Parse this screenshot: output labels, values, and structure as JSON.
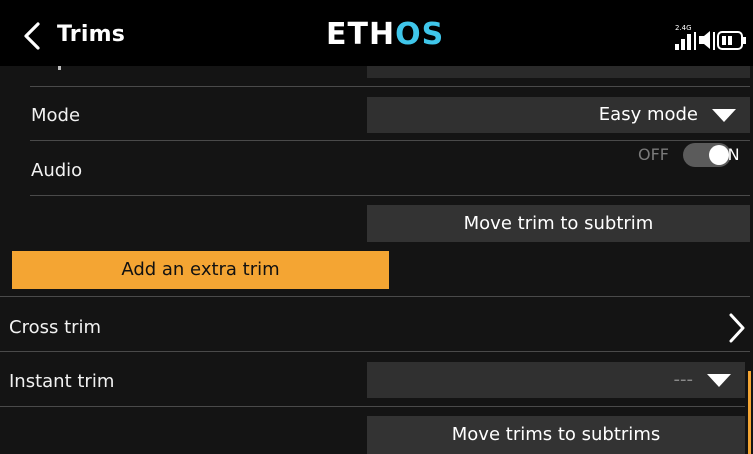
{
  "header": {
    "title": "Trims",
    "logo_part1": "ETH",
    "logo_part2": "OS",
    "status_band": "2.4G"
  },
  "rows": {
    "mode": {
      "label": "Mode",
      "value": "Easy mode"
    },
    "audio": {
      "label": "Audio",
      "off_label": "OFF",
      "on_label": "ON",
      "state": "on"
    },
    "move_trim_button": "Move trim to subtrim",
    "add_extra_trim_button": "Add an extra trim",
    "cross_trim": {
      "label": "Cross trim"
    },
    "instant_trim": {
      "label": "Instant trim",
      "value": "---"
    },
    "move_trims_button": "Move trims to subtrims"
  },
  "colors": {
    "background": "#141414",
    "accent_orange": "#f4a533",
    "logo_blue": "#3fc6ea",
    "field": "#303030"
  },
  "icons": {
    "back": "chevron-left-icon",
    "signal": "signal-bars-icon",
    "volume": "speaker-icon",
    "battery": "battery-icon",
    "dropdown": "triangle-down-icon",
    "submenu": "chevron-right-icon"
  }
}
